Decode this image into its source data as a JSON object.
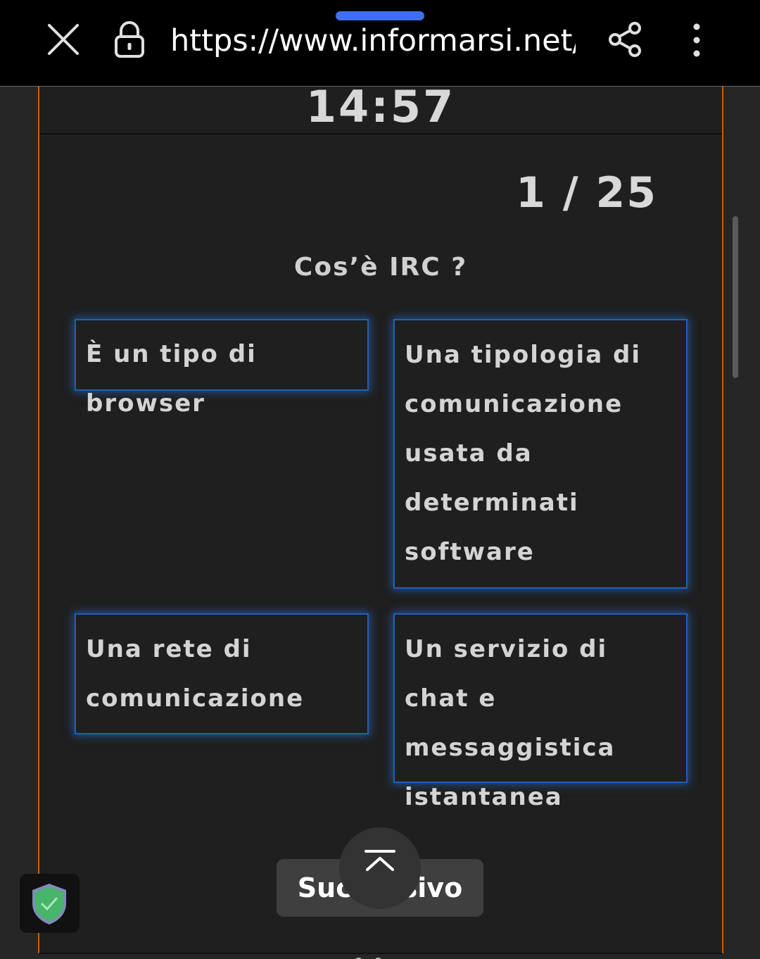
{
  "browser": {
    "url": "https://www.informarsi.net/t",
    "close_icon": "close-icon",
    "lock_icon": "lock-icon",
    "share_icon": "share-icon",
    "menu_icon": "more-vert-icon"
  },
  "quiz": {
    "timer": "14:57",
    "counter": "1 / 25",
    "question": "Cos’è IRC ?",
    "answers": [
      "È un tipo di browser",
      "Una tipologia di comunicazione usata da determinati software",
      "Una rete di comunicazione",
      "Un servizio di chat e messaggistica istantanea"
    ],
    "next_label": "Successivo"
  },
  "colors": {
    "accent_orange": "#c2620e",
    "answer_border": "#1f5fb8",
    "handle_blue": "#3d6ff0"
  }
}
